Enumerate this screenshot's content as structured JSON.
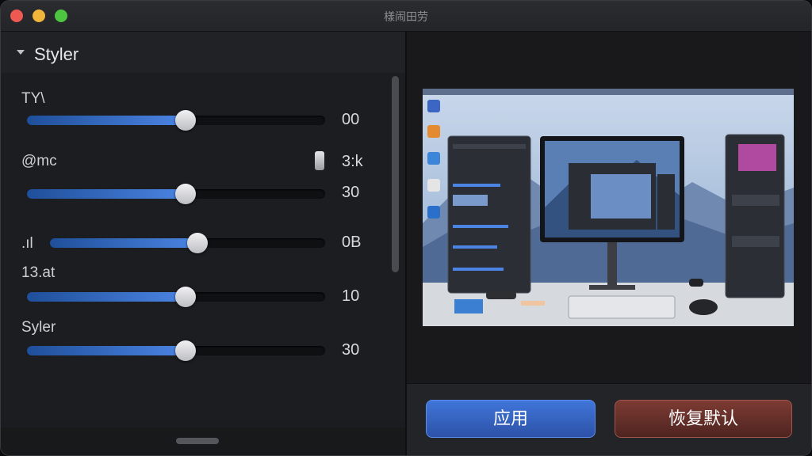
{
  "window": {
    "title": "樣闹田劳"
  },
  "panel": {
    "section_title": "Styler",
    "rows": [
      {
        "label": "TΥ\\",
        "value": "00",
        "level": 0.5
      },
      {
        "label": "@mc",
        "value": "3:k",
        "value2": "30",
        "level": 0.5
      },
      {
        "label": ".ıl",
        "value": "0B",
        "level": 0.5
      },
      {
        "label": "13.at",
        "value": "10",
        "level": 0.5
      },
      {
        "label": "Syler",
        "value": "30",
        "level": 0.5
      }
    ]
  },
  "buttons": {
    "apply": "应用",
    "reset": "恢复默认"
  },
  "colors": {
    "accent": "#3f76d9",
    "reset": "#7d3b33",
    "background": "#1c1d20"
  },
  "preview_image": {
    "icon": "desktop-setup-image"
  }
}
